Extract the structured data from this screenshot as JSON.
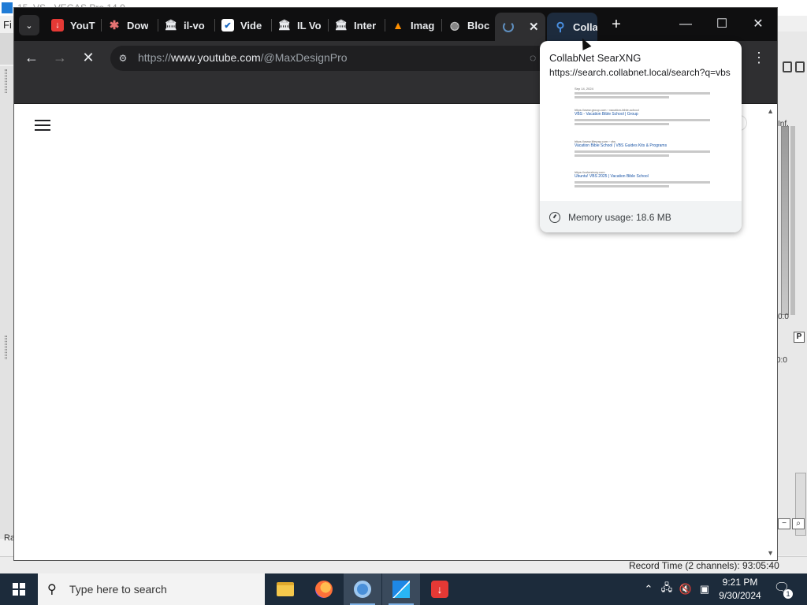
{
  "background_app": {
    "title": "15_VS - VEGAS Pro 14.0",
    "menu_letter": "Fi",
    "left_label": "Ra",
    "meter_top": "Inf.",
    "meter_bottom": "0.0",
    "meter_mode": "P",
    "meter_time": "0:0",
    "record_time": "Record Time (2 channels): 93:05:40"
  },
  "browser": {
    "tab_search_icon": "chevron-down-icon",
    "tabs": [
      {
        "title": "YouT",
        "icon": "download-favicon"
      },
      {
        "title": "Dow",
        "icon": "star-favicon"
      },
      {
        "title": "il-vo",
        "icon": "museum-favicon"
      },
      {
        "title": "Vide",
        "icon": "shield-favicon"
      },
      {
        "title": "IL Vo",
        "icon": "museum-favicon"
      },
      {
        "title": "Inter",
        "icon": "museum-favicon"
      },
      {
        "title": "Imag",
        "icon": "image-favicon"
      },
      {
        "title": "Bloc",
        "icon": "globe-favicon"
      },
      {
        "title": "",
        "icon": "loading-spinner-icon",
        "active": true
      },
      {
        "title": "Colla",
        "icon": "magnifier-favicon",
        "hovered": true
      }
    ],
    "new_tab": "+",
    "window_controls": {
      "minimize": "—",
      "maximize": "☐",
      "close": "✕"
    },
    "address": {
      "scheme": "https://",
      "host": "www.youtube.com",
      "path": "/@MaxDesignPro"
    },
    "hover_card": {
      "title": "CollabNet SearXNG",
      "url": "https://search.collabnet.local/search?q=vbs",
      "memory": "Memory usage: 18.6 MB",
      "preview_results": [
        {
          "url": "Sep 14, 2024",
          "title": ""
        },
        {
          "url": "https://www.group.com › vacation-bible-school",
          "title": "VBS - Vacation Bible School | Group"
        },
        {
          "url": "https://www.lifeway.com › vbs",
          "title": "Vacation Bible School | VBS Guides Kits & Programs"
        },
        {
          "url": "https://cokesbury.com",
          "title": "Ubuntu! VBS 2025 | Vacation Bible School"
        }
      ]
    }
  },
  "taskbar": {
    "search_placeholder": "Type here to search",
    "time": "9:21 PM",
    "date": "9/30/2024",
    "notification_count": "1"
  }
}
